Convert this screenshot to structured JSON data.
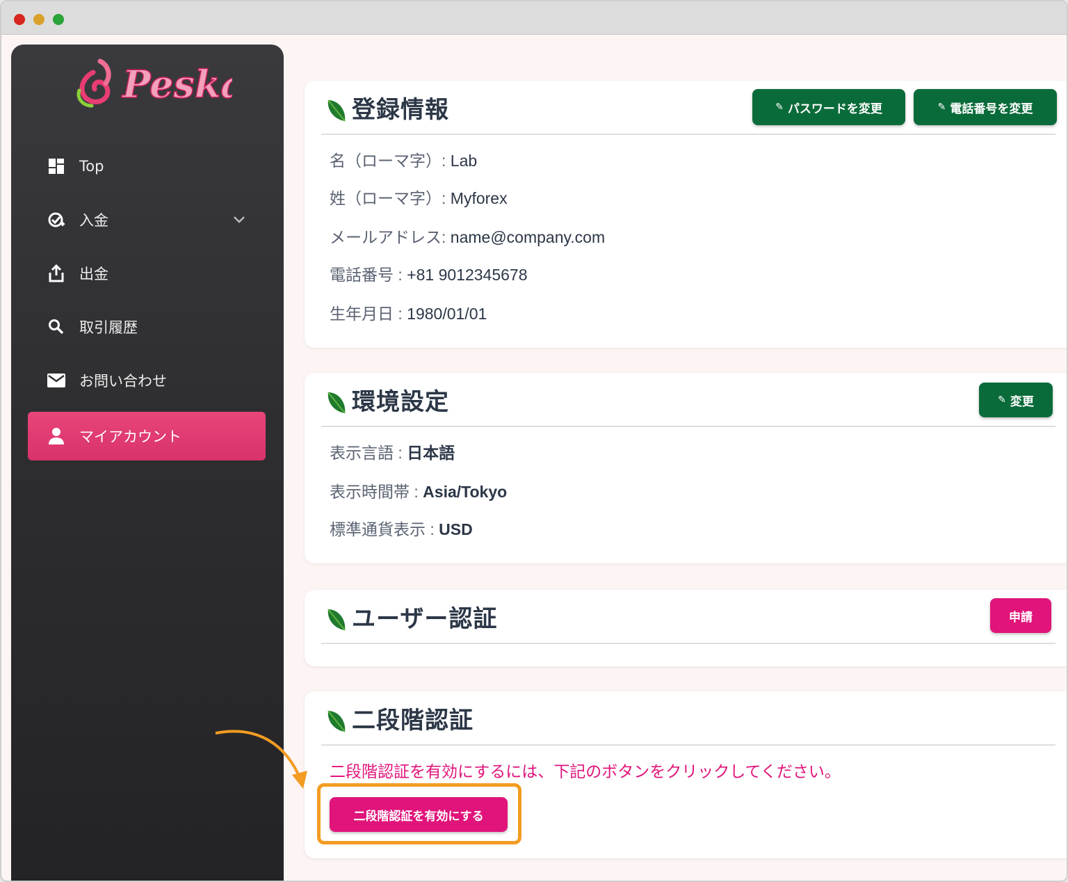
{
  "app": {
    "brand": "Peska"
  },
  "sidebar": {
    "items": [
      {
        "label": "Top",
        "icon": "dashboard-icon"
      },
      {
        "label": "入金",
        "icon": "deposit-icon"
      },
      {
        "label": "出金",
        "icon": "withdraw-icon"
      },
      {
        "label": "取引履歴",
        "icon": "search-icon"
      },
      {
        "label": "お問い合わせ",
        "icon": "mail-icon"
      },
      {
        "label": "マイアカウント",
        "icon": "user-icon"
      }
    ]
  },
  "registration": {
    "title": "登録情報",
    "change_password_label": "パスワードを変更",
    "change_phone_label": "電話番号を変更",
    "fields": [
      {
        "label": "名（ローマ字）:",
        "value": "Lab"
      },
      {
        "label": "姓（ローマ字）:",
        "value": "Myforex"
      },
      {
        "label": "メールアドレス:",
        "value": "name@company.com"
      },
      {
        "label": "電話番号 :",
        "value": "+81 9012345678"
      },
      {
        "label": "生年月日 :",
        "value": "1980/01/01"
      }
    ]
  },
  "preferences": {
    "title": "環境設定",
    "change_label": "変更",
    "fields": [
      {
        "label": "表示言語 :",
        "value": "日本語"
      },
      {
        "label": "表示時間帯 :",
        "value": "Asia/Tokyo"
      },
      {
        "label": "標準通貨表示 :",
        "value": "USD"
      }
    ]
  },
  "verification": {
    "title": "ユーザー認証",
    "apply_label": "申請"
  },
  "two_factor": {
    "title": "二段階認証",
    "notice": "二段階認証を有効にするには、下記のボタンをクリックしてください。",
    "enable_label": "二段階認証を有効にする"
  },
  "colors": {
    "accent_pink": "#e0147a",
    "accent_green": "#0a6b3a",
    "highlight_orange": "#f39c23",
    "sidebar_dark": "#2e2e31"
  }
}
